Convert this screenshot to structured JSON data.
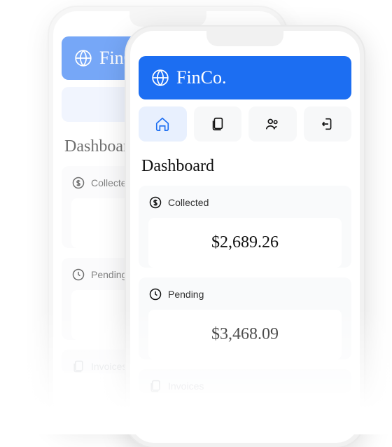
{
  "brand": "FinCo.",
  "page_title": "Dashboard",
  "nav": {
    "home": "home-icon",
    "docs": "document-icon",
    "users": "users-icon",
    "exit": "logout-icon"
  },
  "cards": {
    "collected": {
      "label": "Collected",
      "value": "$2,689.26"
    },
    "pending": {
      "label": "Pending",
      "value": "$3,468.09"
    },
    "invoices": {
      "label": "Invoices"
    }
  }
}
